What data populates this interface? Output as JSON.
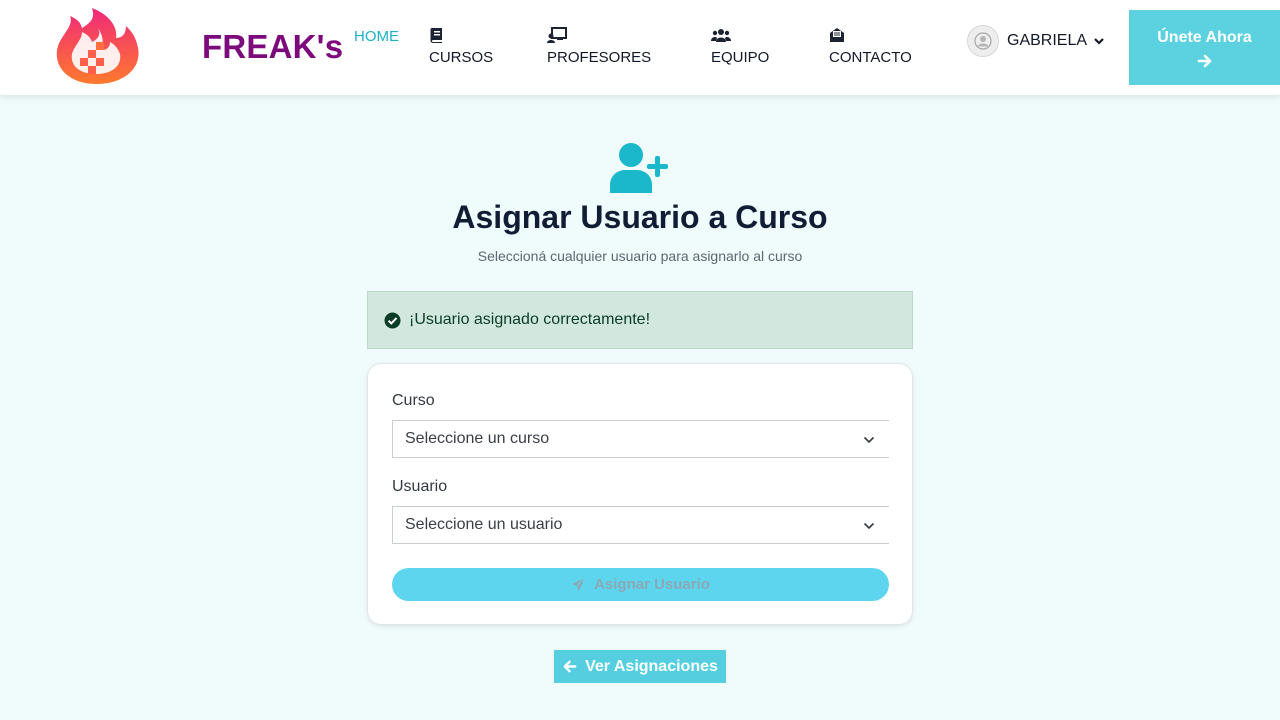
{
  "brand": {
    "name": "FREAK's",
    "logo_icon": "flame-logo-icon"
  },
  "nav": {
    "items": [
      {
        "label": "HOME",
        "icon": "",
        "active": true
      },
      {
        "label": "CURSOS",
        "icon": "book-icon"
      },
      {
        "label": "PROFESORES",
        "icon": "teacher-board-icon"
      },
      {
        "label": "EQUIPO",
        "icon": "users-icon"
      },
      {
        "label": "CONTACTO",
        "icon": "envelope-open-icon"
      }
    ]
  },
  "user": {
    "name": "GABRIELA",
    "avatar_icon": "user-avatar-icon"
  },
  "cta": {
    "label": "Únete Ahora",
    "icon": "arrow-right-icon"
  },
  "page": {
    "icon": "user-plus-icon",
    "title": "Asignar Usuario a Curso",
    "subtitle": "Seleccioná cualquier usuario para asignarlo al curso"
  },
  "alert": {
    "type": "success",
    "icon": "check-circle-icon",
    "message": "¡Usuario asignado correctamente!"
  },
  "form": {
    "curso": {
      "label": "Curso",
      "selected": "Seleccione un curso"
    },
    "usuario": {
      "label": "Usuario",
      "selected": "Seleccione un usuario"
    },
    "submit": {
      "label": "Asignar Usuario",
      "icon": "paper-plane-icon",
      "disabled": true
    }
  },
  "footer_action": {
    "label": "Ver Asignaciones",
    "icon": "arrow-left-icon"
  },
  "colors": {
    "background": "#f0fbfb",
    "brand": "#7d0a7d",
    "accent": "#5cd2e0",
    "nav_active": "#1bb0c6",
    "success_bg": "#d2e8de",
    "success_text": "#0a3d25",
    "title": "#111c35"
  }
}
